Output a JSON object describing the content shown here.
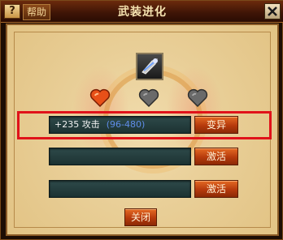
{
  "window": {
    "title": "武装进化",
    "help_icon": "?",
    "help_label": "帮助"
  },
  "hearts": [
    {
      "state": "filled",
      "color": "#e85018"
    },
    {
      "state": "empty",
      "color": "#6a6a6a"
    },
    {
      "state": "empty",
      "color": "#6a6a6a"
    }
  ],
  "rows": [
    {
      "bonus": "+235 攻击",
      "range": "(96-480)",
      "button": "变异",
      "highlighted": true
    },
    {
      "bonus": "",
      "range": "",
      "button": "激活",
      "highlighted": false
    },
    {
      "bonus": "",
      "range": "",
      "button": "激活",
      "highlighted": false
    }
  ],
  "footer": {
    "close_label": "关闭"
  },
  "icons": {
    "item": "weapon-item-icon",
    "close": "close-icon"
  }
}
